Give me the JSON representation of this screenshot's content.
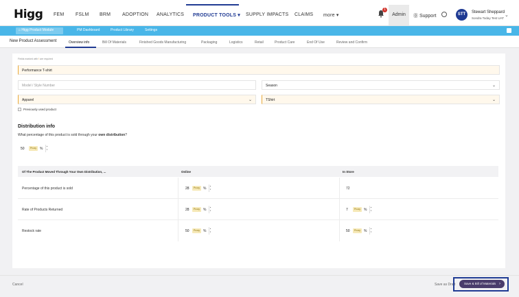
{
  "app": {
    "logo": "Higg"
  },
  "nav": {
    "items": [
      "FEM",
      "FSLM",
      "BRM",
      "ADOPTION",
      "ANALYTICS",
      "PRODUCT TOOLS ▾",
      "SUPPLY IMPACTS",
      "CLAIMS",
      "more ▾"
    ],
    "notifications_count": "1",
    "admin": "Admin",
    "support": "Support",
    "user_initials": "STT",
    "user_name": "Stewart Sheppard",
    "user_org": "Sondra Today Test UAT"
  },
  "subnav": {
    "items": [
      "Higg Product Module",
      "PM Dashboard",
      "Product Library",
      "Settings"
    ]
  },
  "page": {
    "title": "New Product Assessment",
    "tabs": [
      "Overview info",
      "Bill Of Materials",
      "Finished Goods Manufacturing",
      "Packaging",
      "Logistics",
      "Retail",
      "Product Care",
      "End Of Use",
      "Review and Confirm"
    ]
  },
  "form": {
    "required_note_pre": "Fields marked with",
    "required_note_star": "!",
    "required_note_post": "are required",
    "product_name": "Performance T-shirt",
    "model_placeholder": "Model / Style Number",
    "season": "Season",
    "category": "Apparel",
    "subcategory": "TShirt",
    "previously_used": "Previously used product"
  },
  "distribution": {
    "heading": "Distribution info",
    "question_pre": "What percentage of this product is sold through your",
    "question_bold": "own distribution",
    "question_post": "?",
    "value": "50",
    "proxy": "Proxy",
    "pct": "%"
  },
  "table": {
    "headers": [
      "Of The Product Moved Through Your Own Distribution, ...",
      "Online",
      "In Store"
    ],
    "rows": [
      {
        "label": "Percentage of this product is sold",
        "online": "28",
        "instore": "72"
      },
      {
        "label": "Rate of Products Returned",
        "online": "28",
        "instore": "7"
      },
      {
        "label": "Restock rate",
        "online": "50",
        "instore": "50"
      }
    ]
  },
  "footer": {
    "cancel": "Cancel",
    "save_draft": "Save as Draft",
    "save_next": "Save & Bill of Materials"
  },
  "colors": {
    "primary": "#1f3a93",
    "subnav": "#49b6e8",
    "save_button": "#4a3c6b",
    "proxy_badge": "#f6e9b8"
  }
}
